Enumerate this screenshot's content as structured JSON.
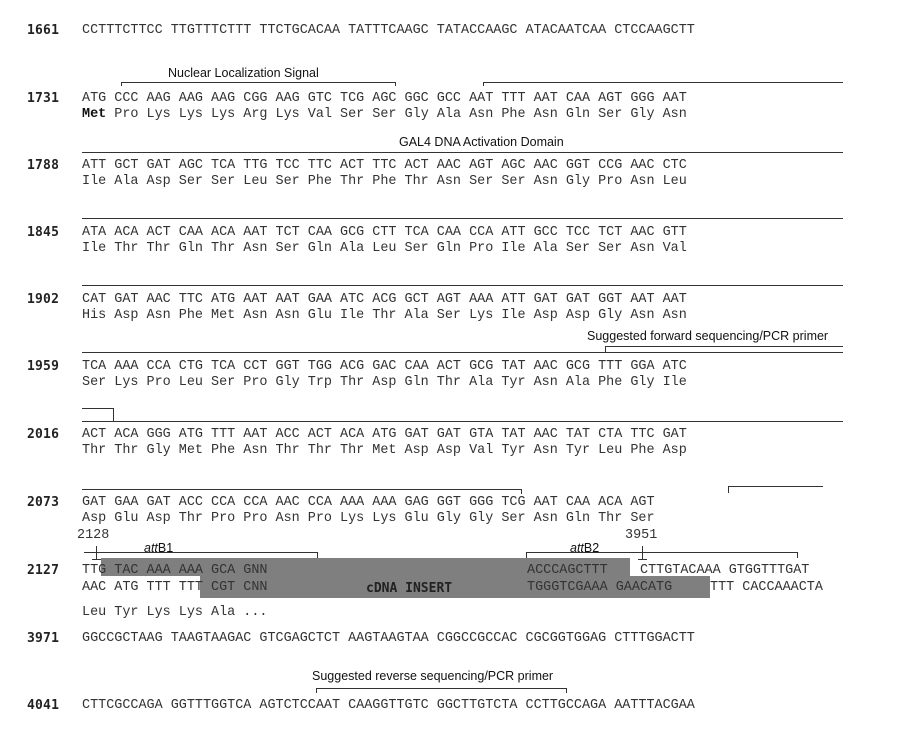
{
  "rows": [
    {
      "num": "1661",
      "seq": "CCTTTCTTCC TTGTTTCTTT TTCTGCACAA TATTTCAAGC TATACCAAGC ATACAATCAA CTCCAAGCTT"
    },
    {
      "num": "1731",
      "seq": "ATG CCC AAG AAG AAG CGG AAG GTC TCG AGC GGC GCC AAT TTT AAT CAA AGT GGG AAT",
      "aa_first": "Met",
      "aa": " Pro Lys Lys Lys Arg Lys Val Ser Ser Gly Ala Asn Phe Asn Gln Ser Gly Asn"
    },
    {
      "num": "1788",
      "seq": "ATT GCT GAT AGC TCA TTG TCC TTC ACT TTC ACT AAC AGT AGC AAC GGT CCG AAC CTC",
      "aa": "Ile Ala Asp Ser Ser Leu Ser Phe Thr Phe Thr Asn Ser Ser Asn Gly Pro Asn Leu"
    },
    {
      "num": "1845",
      "seq": "ATA ACA ACT CAA ACA AAT TCT CAA GCG CTT TCA CAA CCA ATT GCC TCC TCT AAC GTT",
      "aa": "Ile Thr Thr Gln Thr Asn Ser Gln Ala Leu Ser Gln Pro Ile Ala Ser Ser Asn Val"
    },
    {
      "num": "1902",
      "seq": "CAT GAT AAC TTC ATG AAT AAT GAA ATC ACG GCT AGT AAA ATT GAT GAT GGT AAT AAT",
      "aa": "His Asp Asn Phe Met Asn Asn Glu Ile Thr Ala Ser Lys Ile Asp Asp Gly Asn Asn"
    },
    {
      "num": "1959",
      "seq": "TCA AAA CCA CTG TCA CCT GGT TGG ACG GAC CAA ACT GCG TAT AAC GCG TTT GGA ATC",
      "aa": "Ser Lys Pro Leu Ser Pro Gly Trp Thr Asp Gln Thr Ala Tyr Asn Ala Phe Gly Ile"
    },
    {
      "num": "2016",
      "seq": "ACT ACA GGG ATG TTT AAT ACC ACT ACA ATG GAT GAT GTA TAT AAC TAT CTA TTC GAT",
      "aa": "Thr Thr Gly Met Phe Asn Thr Thr Thr Met Asp Asp Val Tyr Asn Tyr Leu Phe Asp"
    },
    {
      "num": "2073",
      "seq": "GAT GAA GAT ACC CCA CCA AAC CCA AAA AAA GAG GGT GGG TCG AAT CAA ACA AGT",
      "aa": "Asp Glu Asp Thr Pro Pro Asn Pro Lys Lys Glu Gly Gly Ser Asn Gln Thr Ser"
    }
  ],
  "insert_row": {
    "num": "2127",
    "top_left": "TTG TAC AAA AAA GCA GNN",
    "bottom_left": "AAC ATG TTT TTT CGT CNN",
    "aa": "Leu Tyr Lys Lys Ala ...",
    "top_right_a": "ACCCAGCTTT",
    "top_right_b": "CTTGTACAAA GTGGTTTGAT",
    "bottom_right_a": "TGGGTCGAAA GAACATG",
    "bottom_right_b": "TTT CACCAAACTA",
    "insert_label": "cDNA INSERT",
    "pos_left": "2128",
    "pos_right": "3951",
    "attb1_prefix": "att",
    "attb1_suffix": "B1",
    "attb2_prefix": "att",
    "attb2_suffix": "B2"
  },
  "tail_rows": [
    {
      "num": "3971",
      "seq": "GGCCGCTAAG TAAGTAAGAC GTCGAGCTCT AAGTAAGTAA CGGCCGCCAC CGCGGTGGAG CTTTGGACTT"
    },
    {
      "num": "4041",
      "seq": "CTTCGCCAGA GGTTTGGTCA AGTCTCCAAT CAAGGTTGTC GGCTTGTCTA CCTTGCCAGA AATTTACGAA"
    }
  ],
  "annotations": {
    "nls": "Nuclear Localization Signal",
    "gal4": "GAL4 DNA  Activation Domain",
    "forward_primer": "Suggested forward sequencing/PCR primer",
    "reverse_primer": "Suggested reverse sequencing/PCR primer"
  },
  "colors": {
    "insert_shade": "#7f7f7f",
    "text": "#333333"
  }
}
